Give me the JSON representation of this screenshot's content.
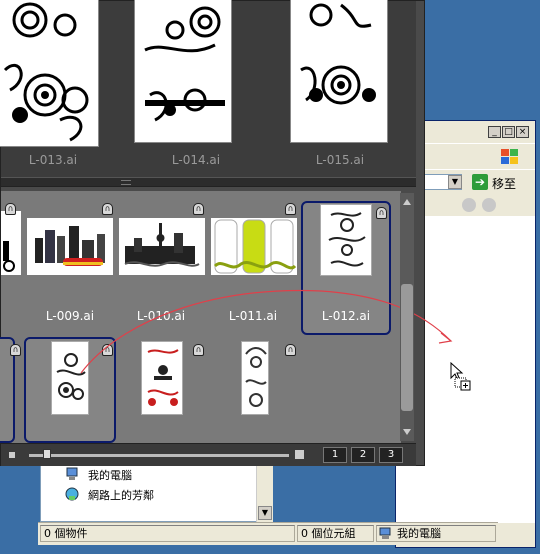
{
  "bridge": {
    "top_row": [
      {
        "caption": "L-013.ai"
      },
      {
        "caption": "L-014.ai"
      },
      {
        "caption": "L-015.ai"
      }
    ],
    "grid_row1": [
      {
        "caption": "L-009.ai"
      },
      {
        "caption": "L-010.ai"
      },
      {
        "caption": "L-011.ai"
      },
      {
        "caption": "L-012.ai"
      }
    ],
    "view_buttons": [
      "1",
      "2",
      "3"
    ]
  },
  "explorer": {
    "go_label": "移至",
    "folders": [
      {
        "label": "我的電腦",
        "icon": "computer-icon"
      },
      {
        "label": "網路上的芳鄰",
        "icon": "network-icon"
      }
    ],
    "status": {
      "objects": "0 個物件",
      "bytes": "0 個位元組",
      "location": "我的電腦"
    }
  },
  "colors": {
    "selection_border": "#0b1a6a",
    "drag_arc": "#e0404a"
  }
}
